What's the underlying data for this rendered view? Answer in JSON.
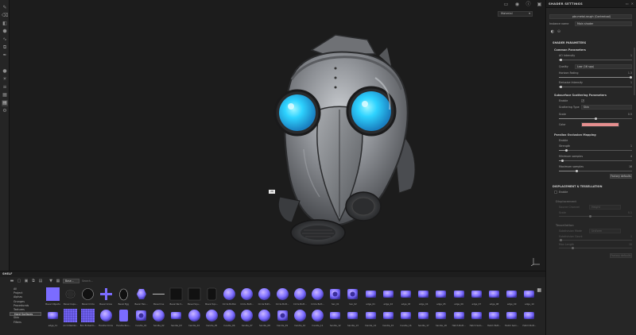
{
  "viewport": {
    "display_mode": "Material",
    "zoom_tag": "26"
  },
  "shader_panel": {
    "title": "SHADER SETTINGS",
    "shader_file": "pbr-metal-rough (Contextual)",
    "instance_name_label": "Instance name",
    "instance_name_value": "Main shader",
    "section_shader_params": "SHADER PARAMETERS",
    "common_params": "Common Parameters",
    "ao_intensity_label": "AO Intensity",
    "ao_intensity_value": "1",
    "quality_label": "Quality",
    "quality_value": "Low (16 spp)",
    "horizon_fading_label": "Horizon Fading",
    "horizon_fading_value": "1.3",
    "emissive_intensity_label": "Emissive Intensity",
    "emissive_intensity_value": "1",
    "sss_params": "Subsurface Scattering Parameters",
    "enable_label": "Enable",
    "scattering_type_label": "Scattering Type",
    "scattering_type_value": "Skin",
    "scale_label": "Scale",
    "scale_value": "0.5",
    "color_label": "Color",
    "color_hex": "#e58e8e",
    "parallax": "Parallax Occlusion Mapping",
    "parallax_enable_label": "Enable",
    "strength_label": "Strength",
    "strength_value": "1",
    "min_samples_label": "Minimum samples",
    "min_samples_value": "4",
    "max_samples_label": "Maximum samples",
    "max_samples_value": "16",
    "factory_defaults": "Factory defaults",
    "section_displacement": "DISPLACEMENT & TESSELLATION",
    "disp_enable_label": "Enable",
    "displacement": "Displacement",
    "source_channel_label": "Source Channel",
    "source_channel_value": "Height",
    "scale2_label": "Scale",
    "scale2_value": "0.1",
    "tessellation": "Tessellation",
    "subdivision_mode_label": "Subdivision Mode",
    "subdivision_mode_value": "Uniform",
    "subdiv_count_label": "Subdivision Count",
    "subdiv_count_value": "1",
    "max_length_label": "Max Length",
    "max_length_value": "10",
    "factory_defaults2": "Factory defaults"
  },
  "shelf": {
    "title": "SHELF",
    "filter_chip": "Base...",
    "search_placeholder": "Search...",
    "categories": [
      "All",
      "Project",
      "Alphas",
      "Grunges",
      "Procedurals",
      "Textures",
      "Hard Surfaces",
      "Skin",
      "Filters"
    ],
    "assets_row1": [
      "Bevel Objects",
      "Bevel Caps...",
      "Bevel Circle",
      "Bevel Cross",
      "Bevel Egg",
      "Bevel Hex...",
      "Bevel line",
      "Bevel Rect...",
      "Bevel Squ...",
      "Bevel Squ...",
      "Circle Button",
      "Circle Butt...",
      "Circle Butt...",
      "Circle Butt...",
      "Circle Butt...",
      "Circle Butt...",
      "hex_01",
      "hex_02",
      "edge_01",
      "edge_02",
      "edge_03",
      "edge_04",
      "edge_05",
      "edge_06",
      "edge_07",
      "edge_08",
      "edge_09",
      "edge_10"
    ],
    "assets_row2": [
      "edge_11",
      "Arch Membr...",
      "Box Embellm...",
      "Handle Circle",
      "Handle Rou...",
      "handle_01",
      "handle_02",
      "handle_03",
      "handle_04",
      "handle_05",
      "handle_06",
      "handle_07",
      "handle_08",
      "handle_09",
      "handle_10",
      "handle_11",
      "handle_12",
      "handle_13",
      "handle_14",
      "handle_15",
      "handle_16",
      "handle_17",
      "handle_18",
      "Hatch Butt...",
      "Hatch Sam...",
      "Hatch Butt...",
      "Hatch Sam...",
      "Hatch Butt..."
    ]
  },
  "colors": {
    "accent": "#7b6cff",
    "eye_glow": "#2ed3ff",
    "panel_bg": "#262626"
  }
}
